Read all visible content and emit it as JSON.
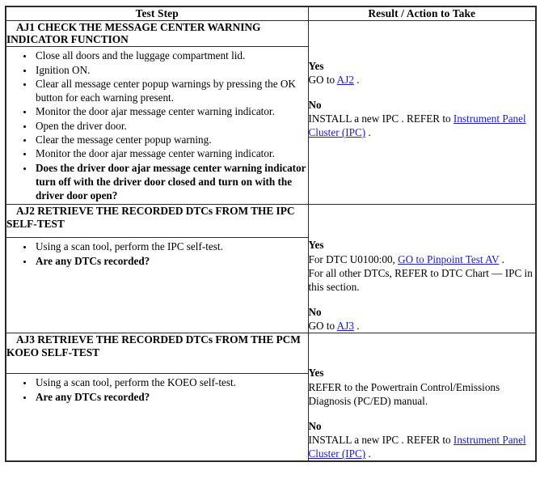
{
  "table": {
    "headers": {
      "test_step": "Test Step",
      "result_action": "Result / Action to Take"
    },
    "link_color": "#1a18d6",
    "border_color": "#2b2b2b",
    "steps": [
      {
        "id": "aj1",
        "title": "AJ1 CHECK THE MESSAGE CENTER WARNING INDICATOR FUNCTION",
        "bullets": [
          {
            "text": "Close all doors and the luggage compartment lid.",
            "bold": false
          },
          {
            "text": "Ignition ON.",
            "bold": false
          },
          {
            "text": "Clear all message center popup warnings by pressing the OK button for each warning present.",
            "bold": false
          },
          {
            "text": "Monitor the door ajar message center warning indicator.",
            "bold": false
          },
          {
            "text": "Open the driver door.",
            "bold": false
          },
          {
            "text": "Clear the message center popup warning.",
            "bold": false
          },
          {
            "text": "Monitor the door ajar message center warning indicator.",
            "bold": false
          },
          {
            "text": "Does the driver door ajar message center warning indicator turn off with the driver door closed and turn on with the driver door open?",
            "bold": true
          }
        ],
        "results": {
          "yes_label": "Yes",
          "yes_text_before": "GO to ",
          "yes_link": "AJ2",
          "yes_text_after": " .",
          "no_label": "No",
          "no_text_before": "INSTALL a new IPC . REFER to ",
          "no_link": "Instrument Panel Cluster (IPC)",
          "no_text_after": " ."
        }
      },
      {
        "id": "aj2",
        "title": "AJ2 RETRIEVE THE RECORDED DTCs FROM THE IPC SELF-TEST",
        "bullets": [
          {
            "text": "Using a scan tool, perform the IPC self-test.",
            "bold": false
          },
          {
            "text": "Are any DTCs recorded?",
            "bold": true
          }
        ],
        "results": {
          "yes_label": "Yes",
          "yes_text_before": "For DTC U0100:00, ",
          "yes_link": "GO to Pinpoint Test AV",
          "yes_text_after": " .",
          "yes_text_extra": "For all other DTCs, REFER to DTC Chart — IPC in this section.",
          "no_label": "No",
          "no_text_before": "GO to ",
          "no_link": "AJ3",
          "no_text_after": " ."
        }
      },
      {
        "id": "aj3",
        "title": "AJ3 RETRIEVE THE RECORDED DTCs FROM THE PCM KOEO SELF-TEST",
        "bullets": [
          {
            "text": "Using a scan tool, perform the KOEO self-test.",
            "bold": false
          },
          {
            "text": "Are any DTCs recorded?",
            "bold": true
          }
        ],
        "results": {
          "yes_label": "Yes",
          "yes_text_plain": "REFER to the Powertrain Control/Emissions Diagnosis (PC/ED) manual.",
          "no_label": "No",
          "no_text_before": "INSTALL a new IPC . REFER to ",
          "no_link": "Instrument Panel Cluster (IPC)",
          "no_text_after": " ."
        }
      }
    ]
  }
}
